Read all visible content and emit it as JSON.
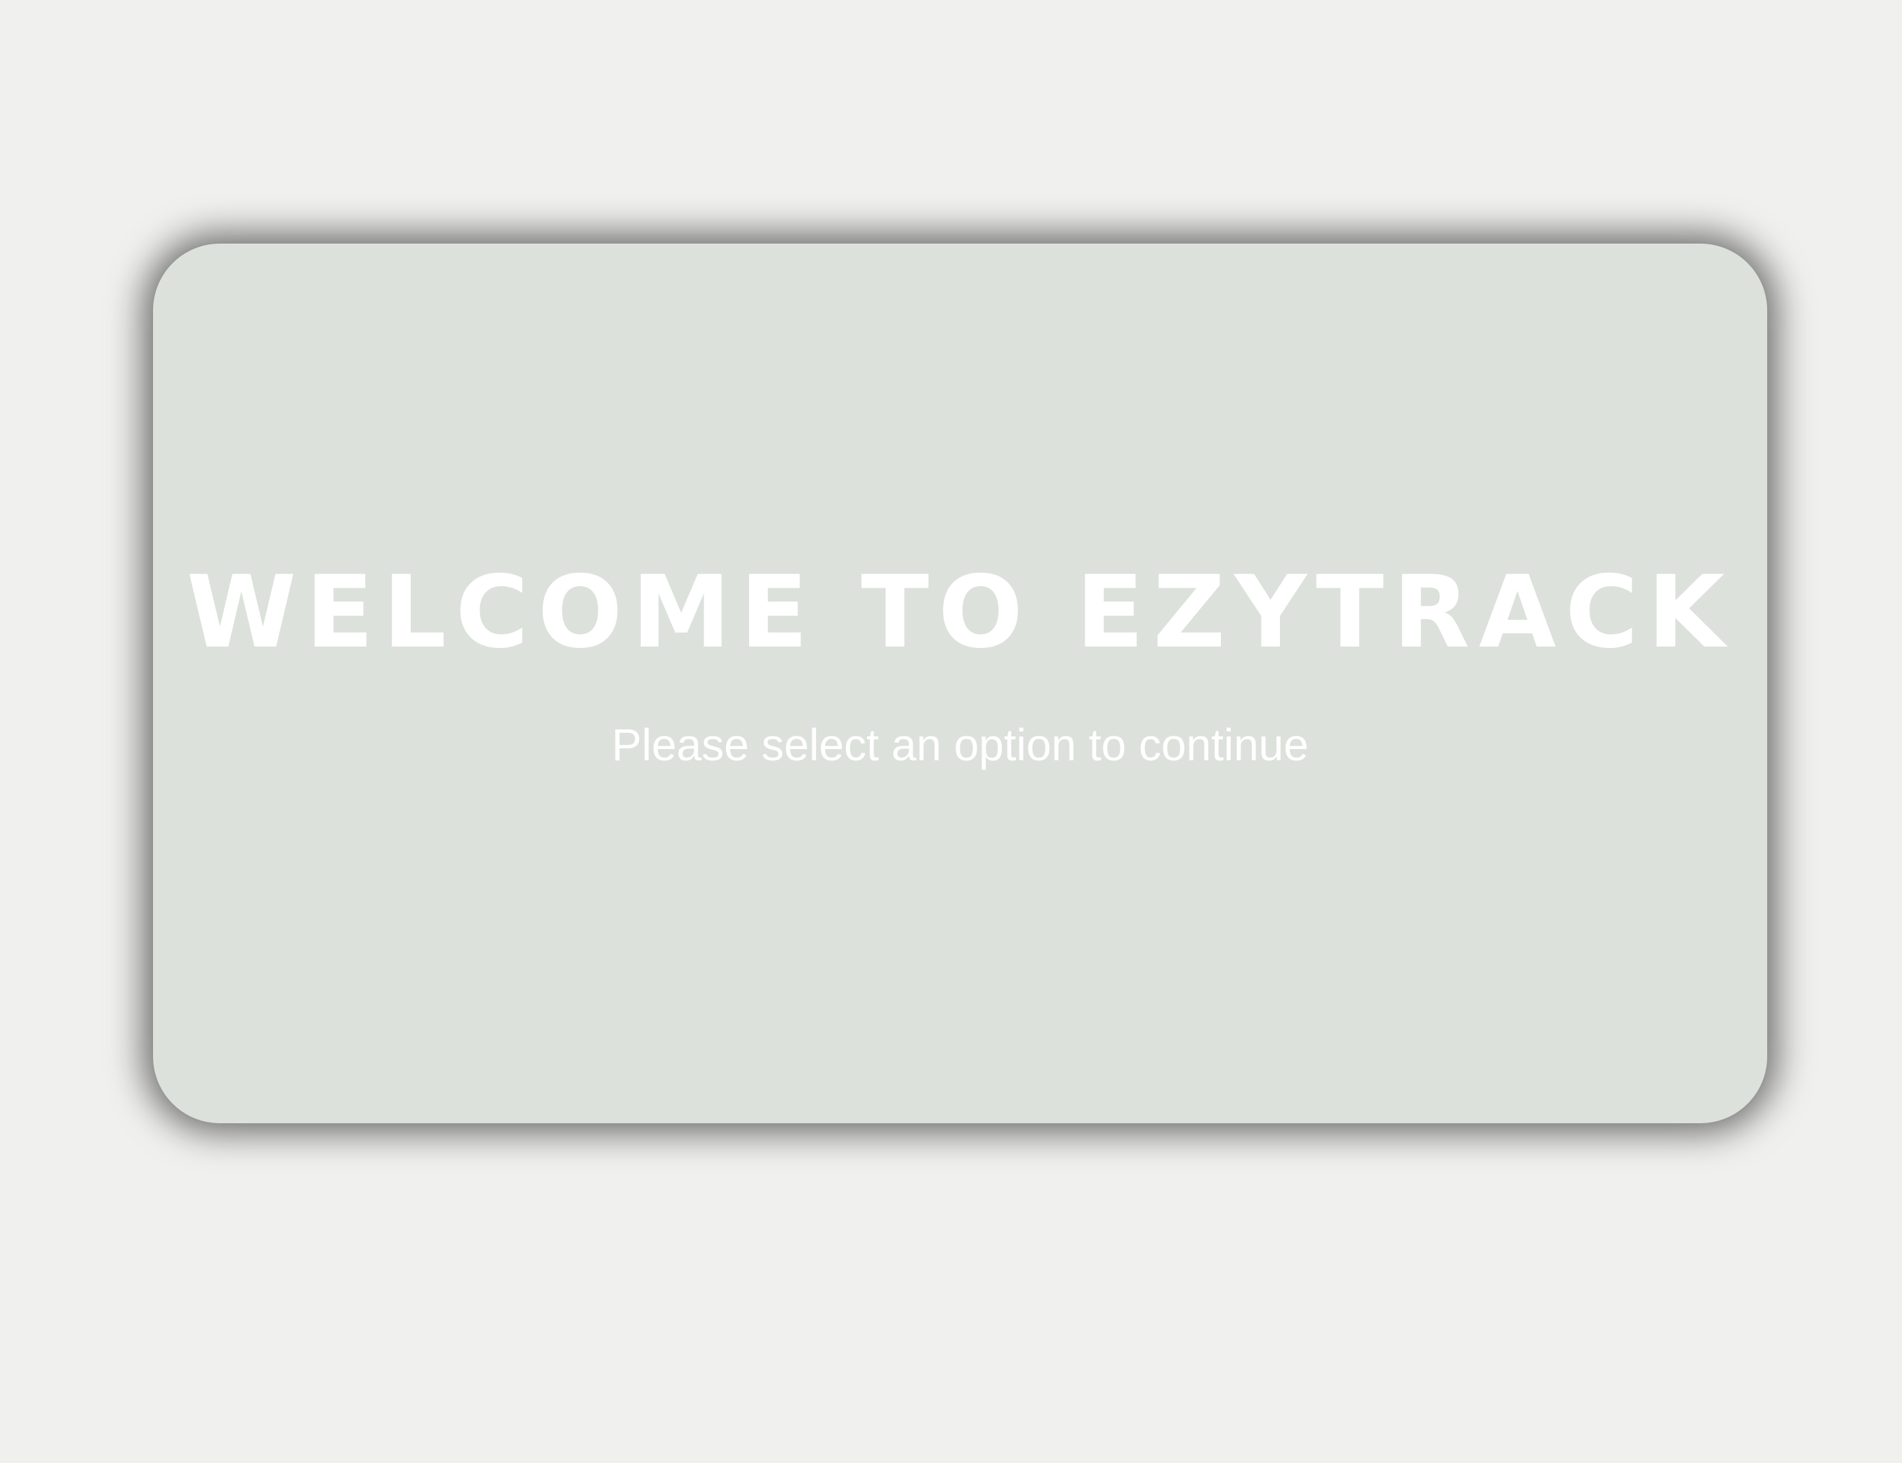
{
  "welcome_card": {
    "title": "WELCOME TO EZYTRACK",
    "subtitle": "Please select an option to continue"
  },
  "colors": {
    "page_background": "#f0f0ee",
    "card_background": "#dce1dc",
    "text": "#ffffff"
  }
}
